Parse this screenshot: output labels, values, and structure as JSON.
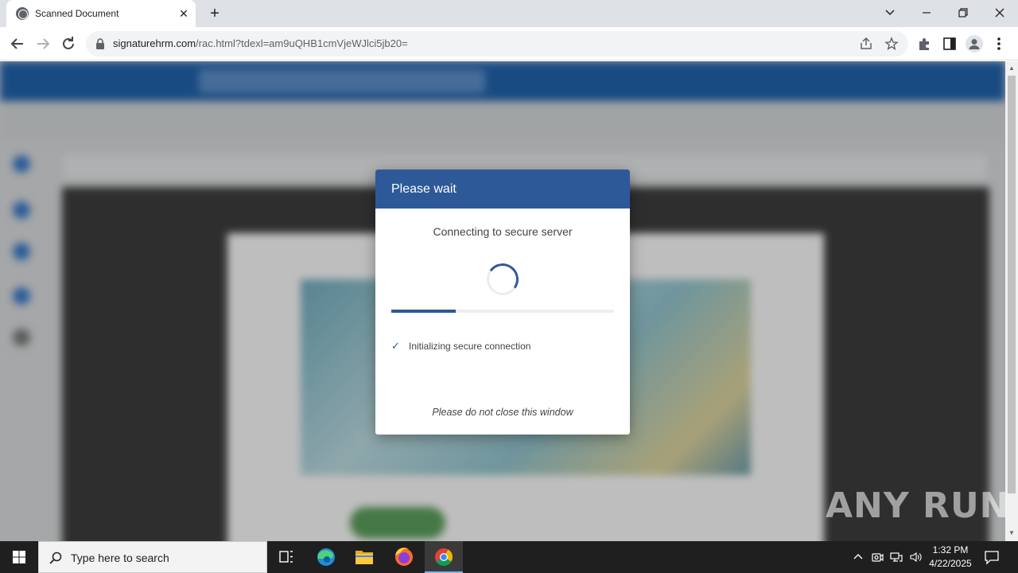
{
  "browser": {
    "tab_title": "Scanned Document",
    "url_host": "signaturehrm.com",
    "url_path": "/rac.html?tdexl=am9uQHB1cmVjeWJlci5jb20="
  },
  "modal": {
    "title": "Please wait",
    "subtitle": "Connecting to secure server",
    "progress": 0.29,
    "step_check": "✓",
    "step_label": "Initializing secure connection",
    "note": "Please do not close this window",
    "accent_color": "#2e5998"
  },
  "watermark": {
    "text": "ANY RUN"
  },
  "taskbar": {
    "search_placeholder": "Type here to search",
    "time": "1:32 PM",
    "date": "4/22/2025",
    "apps": [
      "task-view-icon",
      "edge-icon",
      "file-explorer-icon",
      "firefox-icon",
      "chrome-icon"
    ]
  }
}
